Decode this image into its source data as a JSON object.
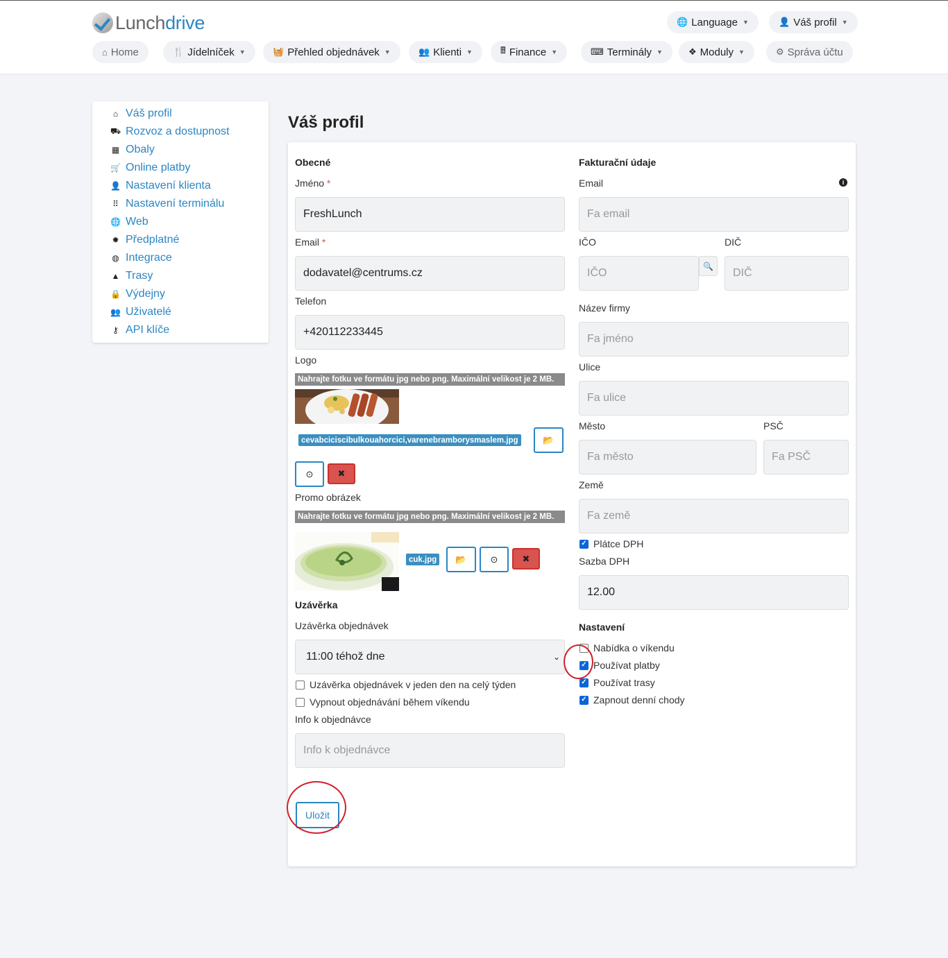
{
  "logo": {
    "part1": "Lunch",
    "part2": "drive"
  },
  "topnav": {
    "language": "Language",
    "profile": "Váš profil",
    "items": [
      "Home",
      "Jídelníček",
      "Přehled objednávek",
      "Klienti",
      "Finance",
      "Terminály",
      "Moduly",
      "Správa účtu"
    ]
  },
  "sidebar": {
    "items": [
      "Váš profil",
      "Rozvoz a dostupnost",
      "Obaly",
      "Online platby",
      "Nastavení klienta",
      "Nastavení terminálu",
      "Web",
      "Předplatné",
      "Integrace",
      "Trasy",
      "Výdejny",
      "Uživatelé",
      "API klíče"
    ]
  },
  "page": {
    "title": "Váš profil"
  },
  "general": {
    "title": "Obecné",
    "name_label": "Jméno",
    "name_value": "FreshLunch",
    "email_label": "Email",
    "email_value": "dodavatel@centrums.cz",
    "phone_label": "Telefon",
    "phone_value": "+420112233445",
    "logo_label": "Logo",
    "upload_hint": "Nahrajte fotku ve formátu jpg nebo png. Maximální velikost je 2 MB.",
    "logo_file": "cevabciciscibulkouahorcici,varenebramborysmaslem.jpg",
    "promo_label": "Promo obrázek",
    "promo_file": "cuk.jpg"
  },
  "cutoff": {
    "title": "Uzávěrka",
    "label": "Uzávěrka objednávek",
    "value": "11:00 téhož dne",
    "check_week": "Uzávěrka objednávek v jeden den na celý týden",
    "check_weekend": "Vypnout objednávání během víkendu",
    "info_label": "Info k objednávce",
    "info_placeholder": "Info k objednávce"
  },
  "billing": {
    "title": "Fakturační údaje",
    "email_label": "Email",
    "email_placeholder": "Fa email",
    "ico_label": "IČO",
    "ico_placeholder": "IČO",
    "dic_label": "DIČ",
    "dic_placeholder": "DIČ",
    "company_label": "Název firmy",
    "company_placeholder": "Fa jméno",
    "street_label": "Ulice",
    "street_placeholder": "Fa ulice",
    "city_label": "Město",
    "city_placeholder": "Fa město",
    "zip_label": "PSČ",
    "zip_placeholder": "Fa PSČ",
    "country_label": "Země",
    "country_placeholder": "Fa země",
    "vat_payer": "Plátce DPH",
    "vat_rate_label": "Sazba DPH",
    "vat_rate_value": "12.00"
  },
  "settings": {
    "title": "Nastavení",
    "weekend_offer": "Nabídka o víkendu",
    "use_payments": "Používat platby",
    "use_routes": "Používat trasy",
    "daily_courses": "Zapnout denní chody"
  },
  "actions": {
    "save": "Uložit"
  },
  "colors": {
    "accent": "#2a86c3",
    "danger": "#d9534f",
    "annotation": "#d0212a"
  }
}
